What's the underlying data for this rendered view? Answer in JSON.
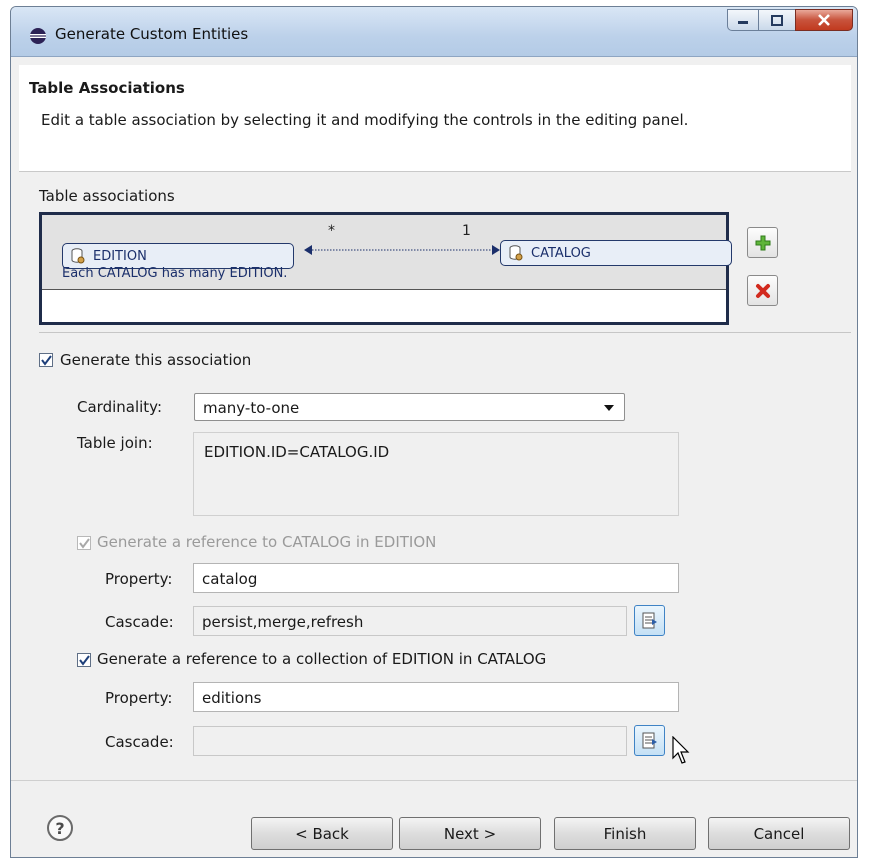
{
  "window": {
    "title": "Generate Custom Entities",
    "controls": {
      "minimize": "minimize-icon",
      "maximize": "maximize-icon",
      "close": "close-icon"
    }
  },
  "header": {
    "title": "Table Associations",
    "description": "Edit a table association by selecting it and modifying the controls in the editing panel."
  },
  "associations": {
    "label": "Table associations",
    "items": [
      {
        "source": "EDITION",
        "target": "CATALOG",
        "source_multiplicity": "*",
        "target_multiplicity": "1",
        "description": "Each CATALOG has many EDITION."
      }
    ],
    "add_icon": "add-icon",
    "delete_icon": "delete-icon"
  },
  "editor": {
    "generate_label": "Generate this association",
    "generate_checked": true,
    "cardinality_label": "Cardinality:",
    "cardinality_value": "many-to-one",
    "table_join_label": "Table join:",
    "table_join_value": "EDITION.ID=CATALOG.ID",
    "ref1": {
      "label": "Generate a reference to CATALOG in EDITION",
      "checked": true,
      "enabled": false,
      "property_label": "Property:",
      "property_value": "catalog",
      "cascade_label": "Cascade:",
      "cascade_value": "persist,merge,refresh"
    },
    "ref2": {
      "label": "Generate a reference to a collection of EDITION in CATALOG",
      "checked": true,
      "enabled": true,
      "property_label": "Property:",
      "property_value": "editions",
      "cascade_label": "Cascade:",
      "cascade_value": ""
    }
  },
  "footer": {
    "help": "?",
    "back": "< Back",
    "next": "Next >",
    "finish": "Finish",
    "cancel": "Cancel"
  }
}
